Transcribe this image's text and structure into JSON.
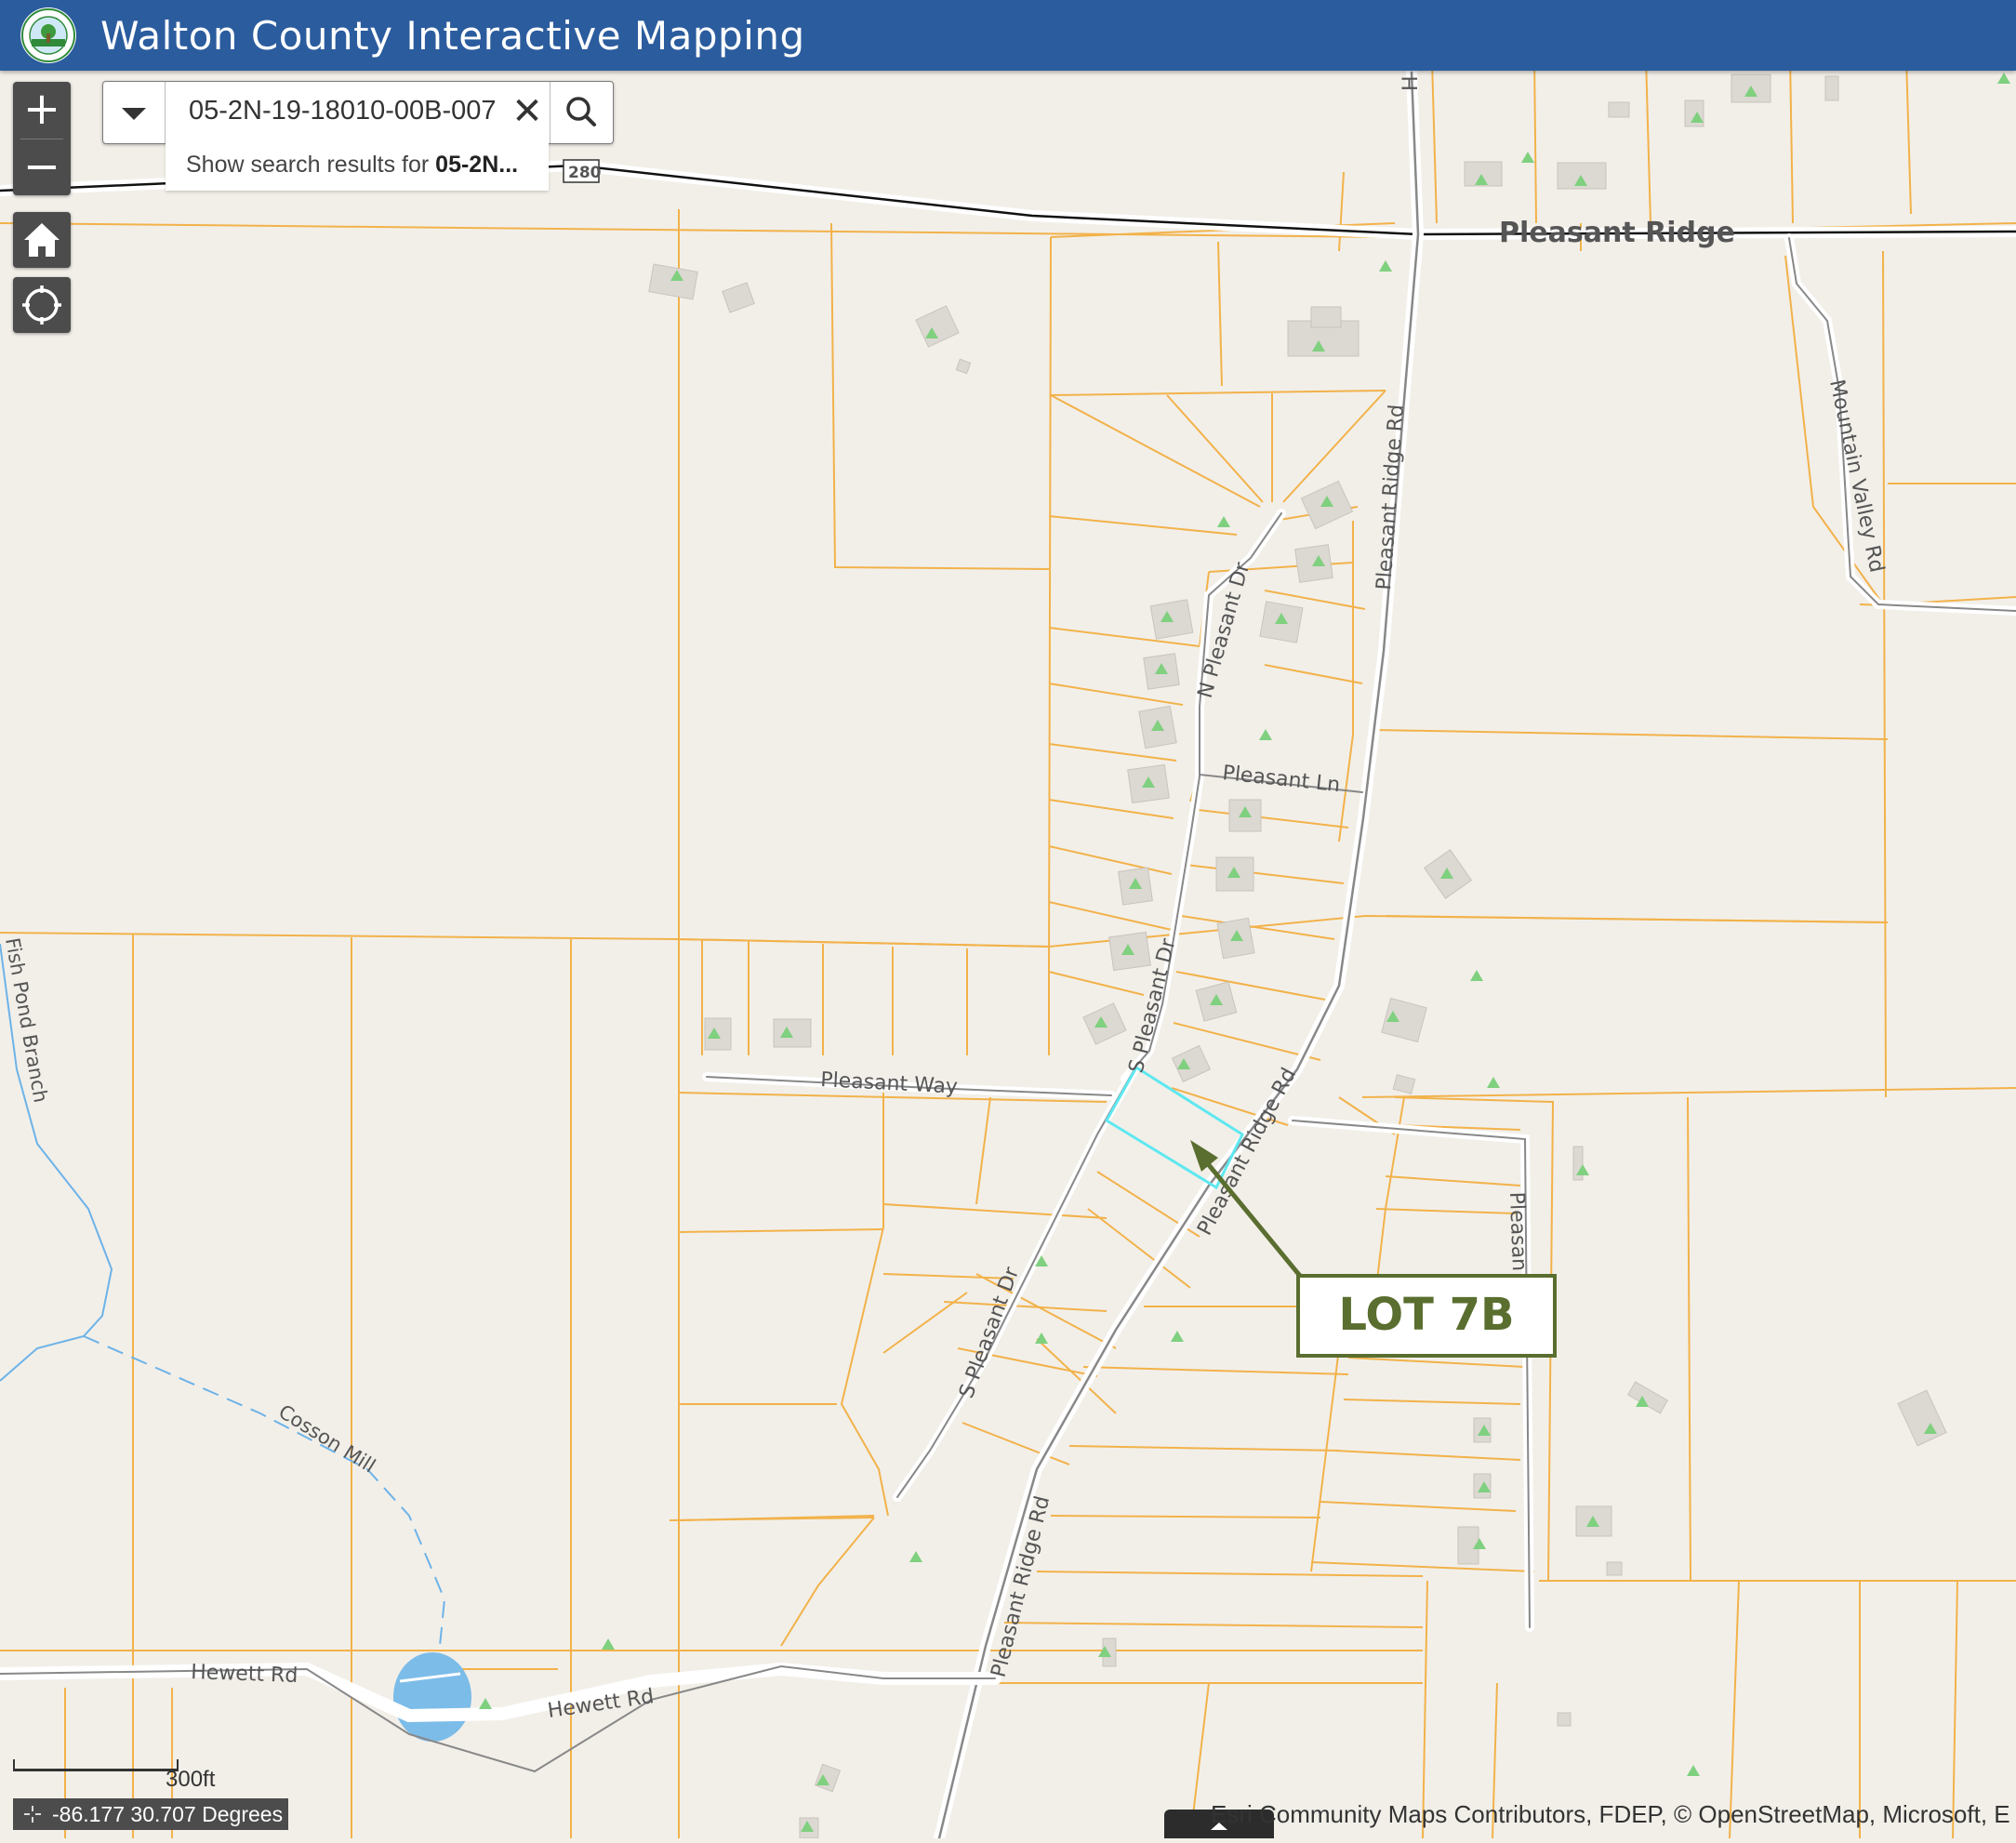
{
  "header": {
    "title": "Walton County Interactive Mapping",
    "logo_icon": "walton-county-seal"
  },
  "zoom": {
    "in_label": "+",
    "out_label": "−"
  },
  "tools": {
    "home_icon": "home-icon",
    "locate_icon": "locate-icon"
  },
  "search": {
    "value": "05-2N-19-18010-00B-007",
    "clear_label": "✕",
    "suggestion_prefix": "Show search results for ",
    "suggestion_term": "05-2N..."
  },
  "map": {
    "roads": {
      "pleasant_ridge": "Pleasant Ridge",
      "route_280": "280",
      "pleasant_ridge_rd": "Pleasant Ridge Rd",
      "mountain_valley_rd": "Mountain Valley Rd",
      "n_pleasant_dr": "N Pleasant Dr",
      "s_pleasant_dr": "S Pleasant Dr",
      "pleasant_ln": "Pleasant Ln",
      "pleasant_way": "Pleasant Way",
      "pleasan": "Pleasan",
      "hewett_rd": "Hewett Rd",
      "h_road": "H"
    },
    "water": {
      "fish_pond_branch": "Fish Pond Branch",
      "cosson_mill": "Cosson Mill"
    },
    "annotation": {
      "label": "LOT 7B",
      "color": "#5a6e2f"
    },
    "colors": {
      "parcel_line": "#f2b24a",
      "highlight": "#5ee8f0",
      "background": "#f2efe9",
      "header": "#2b5c9e"
    }
  },
  "scale": {
    "label": "300ft"
  },
  "coordinates": {
    "text": "-86.177 30.707 Degrees"
  },
  "attribution": {
    "text": "Esri Community Maps Contributors, FDEP, © OpenStreetMap, Microsoft, E"
  }
}
